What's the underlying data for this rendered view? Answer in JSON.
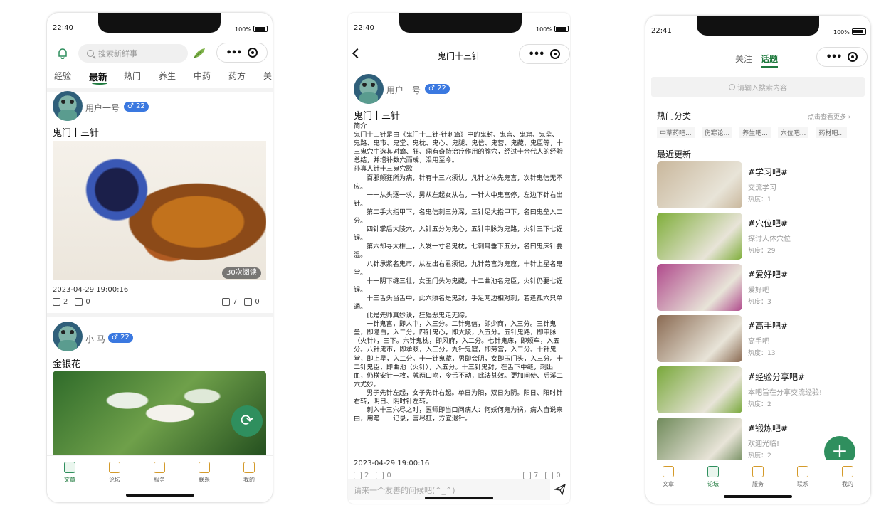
{
  "phone1": {
    "status": {
      "time": "22:40",
      "battery": "100%"
    },
    "search_placeholder": "搜索新鲜事",
    "categories": [
      "经验",
      "最新",
      "热门",
      "养生",
      "中药",
      "药方",
      "关"
    ],
    "active_category": "最新",
    "post1": {
      "user": "用户一号",
      "badge": "♂ 22",
      "title": "鬼门十三针",
      "read_count": "30次阅读",
      "date": "2023-04-29 19:00:16",
      "likes": "2",
      "dislikes": "0",
      "comments": "7",
      "shares": "0"
    },
    "post2": {
      "user": "小 马",
      "badge": "♂ 22",
      "title": "金银花"
    },
    "tabs": [
      "文章",
      "论坛",
      "服务",
      "联系",
      "我的"
    ]
  },
  "phone2": {
    "status": {
      "time": "22:40",
      "battery": "100%"
    },
    "nav_title": "鬼门十三针",
    "user": "用户一号",
    "badge": "♂ 22",
    "title": "鬼门十三针",
    "lines": [
      {
        "t": "简介",
        "indent": false
      },
      {
        "t": "鬼门十三针是由《鬼门十三针·针刺篇》中的鬼封、鬼宫、鬼窟、鬼垒、鬼路、鬼市、鬼堂、鬼枕、鬼心、鬼腿、鬼信、鬼营、鬼藏、鬼臣等，十三鬼穴中选其对癫、狂、痫有奇特治疗作用的腧穴，经过十余代人的经验总结，并增补数穴而成，沿用至今。",
        "indent": false
      },
      {
        "t": "孙真人针十三鬼穴歌",
        "indent": false
      },
      {
        "t": "百邪颠狂所为病，针有十三穴须认，凡针之体先鬼宫，次针鬼信无不应。",
        "indent": true
      },
      {
        "t": "一一从头逐一求，男从左起女从右，一针人中鬼宫停，左边下针右出针。",
        "indent": true
      },
      {
        "t": "第二手大指甲下，名鬼信刺三分深，三针足大指甲下，名曰鬼垒入二分。",
        "indent": true
      },
      {
        "t": "四针掌后大陵穴，入针五分为鬼心，五针申脉为鬼路，火针三下七锃锃。",
        "indent": true
      },
      {
        "t": "第六却寻大椎上，入发一寸名鬼枕，七刺耳垂下五分，名曰鬼床针要温。",
        "indent": true
      },
      {
        "t": "八针承浆名鬼市，从左出右君须记，九针劳宫为鬼窟，十针上星名鬼堂。",
        "indent": true
      },
      {
        "t": "十一阴下缝三壮，女玉门头为鬼藏，十二曲池名鬼臣，火针仍要七锃锃。",
        "indent": true
      },
      {
        "t": "十三舌头当舌中，此穴须名是鬼封，手足两边相对刺，若逢孤穴只单通。",
        "indent": true
      },
      {
        "t": "此是先师真妙诀，狂猖恶鬼走无踪。",
        "indent": true
      },
      {
        "t": "一针鬼宫，即人中，入三分。二针鬼信，即少商，入三分。三针鬼垒，即隐白，入二分。四针鬼心，即大陵，入五分。五针鬼路，即申脉（火针），三下。六针鬼枕，即风府，入二分。七针鬼床，即颊车，入五分。八针鬼市，即承浆，入三分。九针鬼窟，即劳宫，入二分。十针鬼堂，即上星，入二分。十一针鬼藏，男即会阴，女即玉门头，入三分。十二针鬼臣，即曲池（火针），入五分。十三针鬼封，在舌下中缝，刺出血，仍横安针一枚，就两口吻，令舌不动，此法甚效。更加间使、后溪二穴尤妙。",
        "indent": true
      },
      {
        "t": "男子先针左起，女子先针右起。单日为阳，双日为阴。阳日、阳时针右转，阴日、阴时针左转。",
        "indent": true
      },
      {
        "t": "刺入十三穴尽之时，医师即当口问病人：何妖何鬼为祸，病人自说来由，用笔一一记录，言尽狂，方宜退针。",
        "indent": true
      }
    ],
    "date": "2023-04-29 19:00:16",
    "likes": "2",
    "dislikes": "0",
    "comments": "7",
    "shares": "0",
    "comment_placeholder": "请来一个友善的问候吧(^_^)"
  },
  "phone3": {
    "status": {
      "time": "22:41",
      "battery": "100%"
    },
    "top_tabs": [
      "关注",
      "话题"
    ],
    "active_top_tab": "话题",
    "search_placeholder": "请输入搜索内容",
    "hot_title": "热门分类",
    "hot_more": "点击查看更多",
    "chips": [
      "中草药吧...",
      "伤寒论...",
      "养生吧...",
      "穴位吧...",
      "药材吧..."
    ],
    "recent_title": "最近更新",
    "topics": [
      {
        "name": "#学习吧#",
        "desc": "交流学习",
        "heat": "热度：1",
        "color": "#c9b79c"
      },
      {
        "name": "#穴位吧#",
        "desc": "探讨人体穴位",
        "heat": "热度：29",
        "color": "#7fae3a"
      },
      {
        "name": "#爱好吧#",
        "desc": "爱好吧",
        "heat": "热度：3",
        "color": "#b04a8c"
      },
      {
        "name": "#高手吧#",
        "desc": "高手吧",
        "heat": "热度：13",
        "color": "#8a6a52"
      },
      {
        "name": "#经验分享吧#",
        "desc": "本吧旨在分享交流经验!",
        "heat": "热度：2",
        "color": "#78a83a"
      },
      {
        "name": "#锻炼吧#",
        "desc": "欢迎光临!",
        "heat": "热度：2",
        "color": "#6f8a5a"
      }
    ],
    "tabs": [
      "文章",
      "论坛",
      "服务",
      "联系",
      "我的"
    ]
  }
}
